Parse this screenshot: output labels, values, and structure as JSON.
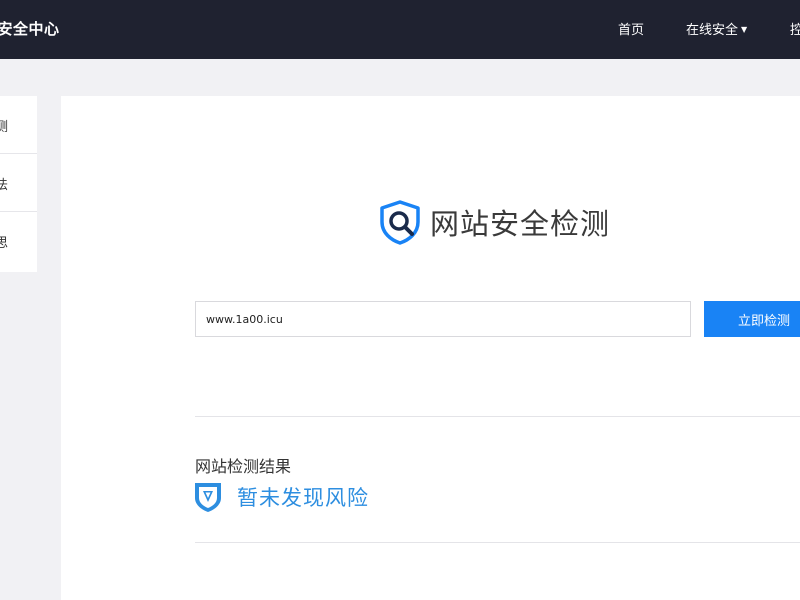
{
  "header": {
    "title": "址安全中心",
    "nav": {
      "home": "首页",
      "online_security": "在线安全",
      "online_security_caret": "▼",
      "cut_item": "控"
    }
  },
  "sidebar": {
    "items": [
      {
        "label": "测"
      },
      {
        "label": "法"
      },
      {
        "label": "思"
      }
    ]
  },
  "main": {
    "logo_icon": "shield-search-icon",
    "title": "网站安全检测",
    "search": {
      "value": "www.1a00.icu",
      "placeholder": ""
    },
    "check_button": "立即检测",
    "result": {
      "heading": "网站检测结果",
      "icon": "shield-check-icon",
      "status": "暂未发现风险"
    }
  },
  "colors": {
    "header_bg": "#1f2230",
    "accent_blue": "#1983f5",
    "result_blue": "#2d8ee0",
    "page_bg": "#f1f1f4"
  }
}
